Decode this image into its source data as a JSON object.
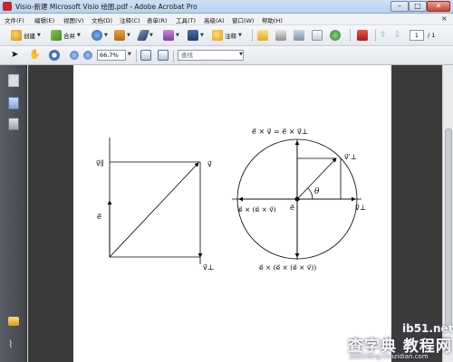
{
  "window": {
    "title": "Visio-新建 Microsoft Visio 绘图.pdf - Adobe Acrobat Pro",
    "minimize": "–",
    "maximize": "□",
    "close": "✕"
  },
  "menu": {
    "items": [
      "文件(F)",
      "编辑(E)",
      "视图(V)",
      "文档(D)",
      "注释(C)",
      "表单(R)",
      "工具(T)",
      "高级(A)",
      "窗口(W)",
      "帮助(H)"
    ],
    "close_doc": "×"
  },
  "toolbar1": {
    "create_label": "创建",
    "combine_label": "合并",
    "comment_label": "注释",
    "page_current": "1",
    "page_total": "/ 1"
  },
  "toolbar2": {
    "zoom_value": "66.7%",
    "find_placeholder": "查找"
  },
  "diagram": {
    "left_labels": {
      "v_parallel": "v⃗∥",
      "v": "v⃗",
      "e": "e⃗",
      "v_perp": "v⃗⊥"
    },
    "right_labels": {
      "top_eq": "e⃗ × v⃗ = e⃗ × v⃗⊥",
      "v_perp_prime": "v⃗′⊥",
      "theta": "θ",
      "e": "e⃗",
      "v_perp": "v⃗⊥",
      "left_eq": "e⃗ × (e⃗ × v⃗)",
      "bottom_eq": "e⃗ × (e⃗ × (e⃗ × v⃗))"
    }
  },
  "watermark": {
    "site": "ib51.net",
    "cn": "查字典 教程网",
    "sub": "jiaocheng.chazidian.com"
  },
  "colors": {
    "page_bg": "#ffffff",
    "doc_bg": "#3b3b3b",
    "nav_bg": "#4a4e54",
    "accent_red": "#c1272d"
  }
}
